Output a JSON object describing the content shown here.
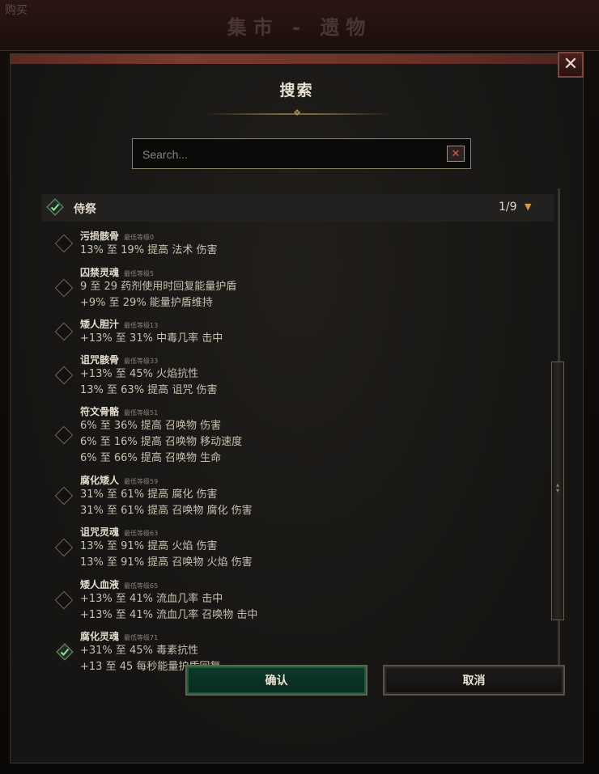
{
  "background": {
    "tab_label": "购买",
    "title": "集市 - 遗物"
  },
  "modal": {
    "title": "搜索",
    "close_symbol": "✕",
    "search": {
      "placeholder": "Search...",
      "value": "",
      "clear_symbol": "✕"
    },
    "category": {
      "label": "侍祭",
      "count": "1/9",
      "checked": true
    },
    "items": [
      {
        "name": "污损骸骨",
        "level": "最低等级0",
        "checked": false,
        "mods": [
          "13% 至 19% 提高 法术 伤害"
        ]
      },
      {
        "name": "囚禁灵魂",
        "level": "最低等级5",
        "checked": false,
        "mods": [
          "9 至 29 药剂使用时回复能量护盾",
          "+9% 至 29% 能量护盾维持"
        ]
      },
      {
        "name": "矮人胆汁",
        "level": "最低等级13",
        "checked": false,
        "mods": [
          "+13% 至 31% 中毒几率 击中"
        ]
      },
      {
        "name": "诅咒骸骨",
        "level": "最低等级33",
        "checked": false,
        "mods": [
          "+13% 至 45% 火焰抗性",
          "13% 至 63% 提高 诅咒 伤害"
        ]
      },
      {
        "name": "符文骨骼",
        "level": "最低等级51",
        "checked": false,
        "mods": [
          "6% 至 36% 提高 召唤物 伤害",
          "6% 至 16% 提高 召唤物 移动速度",
          "6% 至 66% 提高 召唤物 生命"
        ]
      },
      {
        "name": "腐化矮人",
        "level": "最低等级59",
        "checked": false,
        "mods": [
          "31% 至 61% 提高 腐化 伤害",
          "31% 至 61% 提高 召唤物 腐化 伤害"
        ]
      },
      {
        "name": "诅咒灵魂",
        "level": "最低等级63",
        "checked": false,
        "mods": [
          "13% 至 91% 提高 火焰 伤害",
          "13% 至 91% 提高 召唤物 火焰 伤害"
        ]
      },
      {
        "name": "矮人血液",
        "level": "最低等级65",
        "checked": false,
        "mods": [
          "+13% 至 41% 流血几率 击中",
          "+13% 至 41% 流血几率 召唤物 击中"
        ]
      },
      {
        "name": "腐化灵魂",
        "level": "最低等级71",
        "checked": true,
        "mods": [
          "+31% 至 45% 毒素抗性",
          "+13 至 45 每秒能量护盾回复"
        ]
      }
    ],
    "buttons": {
      "confirm": "确认",
      "cancel": "取消"
    },
    "colors": {
      "accent_green": "#1d5a44",
      "check_green": "#7ed08a",
      "arrow_orange": "#d89a40",
      "close_red": "#e05a4a"
    }
  }
}
